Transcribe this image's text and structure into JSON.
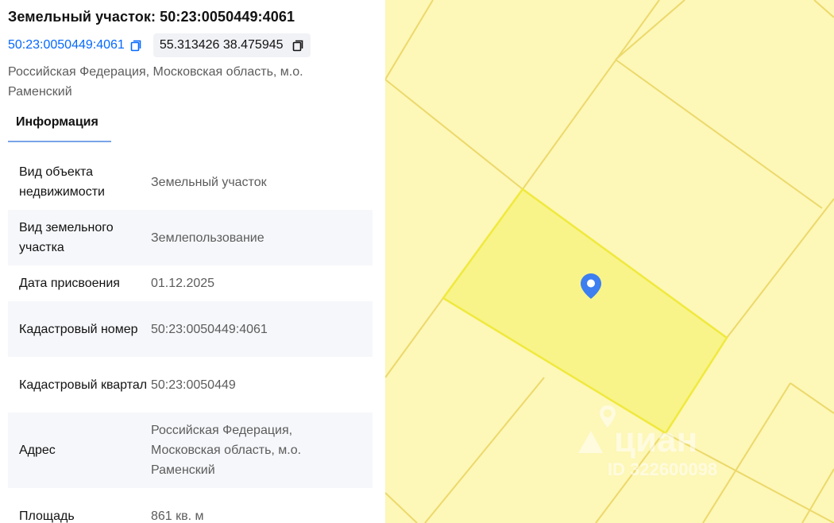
{
  "header": {
    "title": "Земельный участок: 50:23:0050449:4061",
    "cadastral_link": "50:23:0050449:4061",
    "coordinates": "55.313426 38.475945",
    "address": "Российская Федерация, Московская область, м.о. Раменский"
  },
  "tabs": [
    {
      "label": "Информация"
    }
  ],
  "info_rows": [
    {
      "key": "Вид объекта недвижимости",
      "value": "Земельный участок"
    },
    {
      "key": "Вид земельного участка",
      "value": "Землепользование"
    },
    {
      "key": "Дата присвоения",
      "value": "01.12.2025"
    },
    {
      "key": "Кадастровый номер",
      "value": "50:23:0050449:4061"
    },
    {
      "key": "Кадастровый квартал",
      "value": "50:23:0050449"
    },
    {
      "key": "Адрес",
      "value": "Российская Федерация, Московская область, м.о. Раменский"
    },
    {
      "key": "Площадь",
      "value": "861 кв. м"
    }
  ],
  "map": {
    "watermark_logo": "циан",
    "watermark_id": "ID 322600098",
    "marker_icon": "location-pin-icon",
    "colors": {
      "parcel_fill": "#f8f48a",
      "parcel_stroke": "#f0e93e",
      "background": "#fdf7b8",
      "grid_line": "#ecd96b",
      "pin": "#3d7ef0"
    }
  }
}
